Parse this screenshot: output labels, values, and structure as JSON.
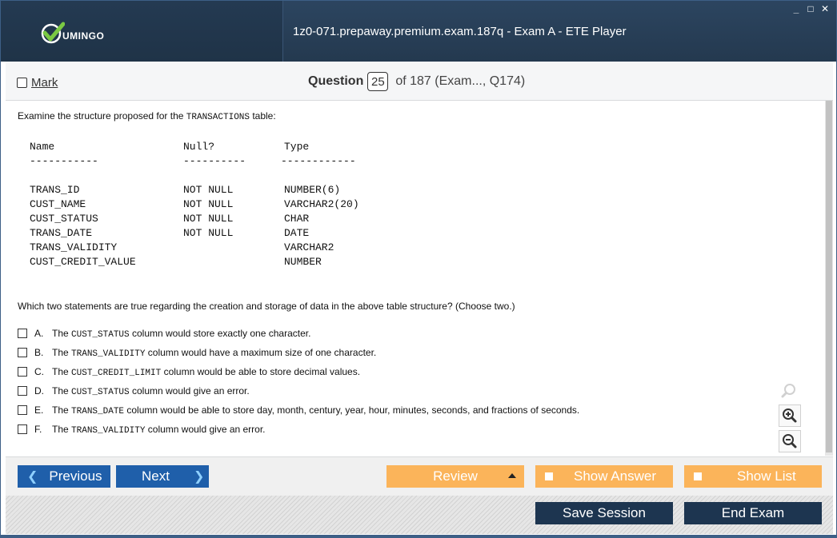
{
  "window": {
    "title": "1z0-071.prepaway.premium.exam.187q - Exam A - ETE Player",
    "logo_text": "UMINGO",
    "controls": [
      "_",
      "□",
      "✕"
    ]
  },
  "header": {
    "mark_label": "Mark",
    "question_label": "Question",
    "question_number": "25",
    "question_of": "of 187 (Exam..., Q174)"
  },
  "content": {
    "prompt_before": "Examine the structure proposed for the ",
    "prompt_code": "TRANSACTIONS",
    "prompt_after": " table:",
    "table_header": [
      "Name",
      "Null?",
      "Type"
    ],
    "table_separators": [
      "-----------",
      "----------",
      "------------"
    ],
    "table_rows": [
      [
        "TRANS_ID",
        "NOT NULL",
        "NUMBER(6)"
      ],
      [
        "CUST_NAME",
        "NOT NULL",
        "VARCHAR2(20)"
      ],
      [
        "CUST_STATUS",
        "NOT NULL",
        "CHAR"
      ],
      [
        "TRANS_DATE",
        "NOT NULL",
        "DATE"
      ],
      [
        "TRANS_VALIDITY",
        "",
        "VARCHAR2"
      ],
      [
        "CUST_CREDIT_VALUE",
        "",
        "NUMBER"
      ]
    ],
    "question_text": "Which two statements are true regarding the creation and storage of data in the above table structure? (Choose two.)",
    "options": [
      {
        "letter": "A.",
        "pre": "The ",
        "code": "CUST_STATUS",
        "post": " column would store exactly one character."
      },
      {
        "letter": "B.",
        "pre": "The ",
        "code": "TRANS_VALIDITY",
        "post": " column would have a maximum size of one character."
      },
      {
        "letter": "C.",
        "pre": "The ",
        "code": "CUST_CREDIT_LIMIT",
        "post": " column would be able to store decimal values."
      },
      {
        "letter": "D.",
        "pre": "The ",
        "code": "CUST_STATUS",
        "post": " column would give an error."
      },
      {
        "letter": "E.",
        "pre": "The ",
        "code": "TRANS_DATE",
        "post": " column would be able to store day, month, century, year, hour, minutes, seconds, and fractions of seconds."
      },
      {
        "letter": "F.",
        "pre": "The ",
        "code": "TRANS_VALIDITY",
        "post": " column would give an error."
      }
    ]
  },
  "nav": {
    "previous": "Previous",
    "next": "Next",
    "review": "Review",
    "show_answer": "Show Answer",
    "show_list": "Show List"
  },
  "bottom": {
    "save_session": "Save Session",
    "end_exam": "End Exam"
  },
  "colors": {
    "title_bar": "#24394f",
    "nav_blue": "#1f5faa",
    "nav_orange": "#fbb45a",
    "bottom_dark": "#1d3550",
    "logo_green": "#7ac943"
  },
  "icons": [
    "check-logo-icon",
    "zoom-icon",
    "zoom-in-icon",
    "zoom-out-icon",
    "chevron-left-icon",
    "chevron-right-icon",
    "triangle-up-icon"
  ]
}
